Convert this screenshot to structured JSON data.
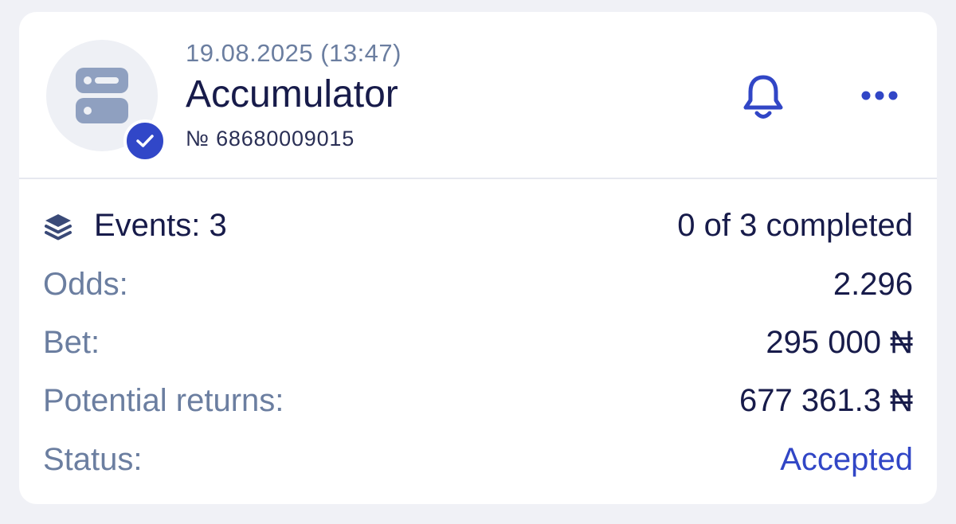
{
  "header": {
    "date": "19.08.2025 (13:47)",
    "bet_type": "Accumulator",
    "ticket_number": "№ 68680009015"
  },
  "icons": {
    "avatar": "bet-slip-icon",
    "badge": "check-badge-icon",
    "bell": "bell-icon",
    "more": "more-dots-icon",
    "events": "layers-icon"
  },
  "details": {
    "events_label": "Events: 3",
    "events_progress": "0 of 3 completed",
    "odds_label": "Odds:",
    "odds_value": "2.296",
    "bet_label": "Bet:",
    "bet_value": "295 000 ₦",
    "returns_label": "Potential returns:",
    "returns_value": "677 361.3 ₦",
    "status_label": "Status:",
    "status_value": "Accepted"
  },
  "colors": {
    "accent": "#3146c6",
    "text_primary": "#171b4a",
    "text_secondary": "#6b7ea0",
    "background": "#f0f1f6",
    "card": "#ffffff"
  }
}
